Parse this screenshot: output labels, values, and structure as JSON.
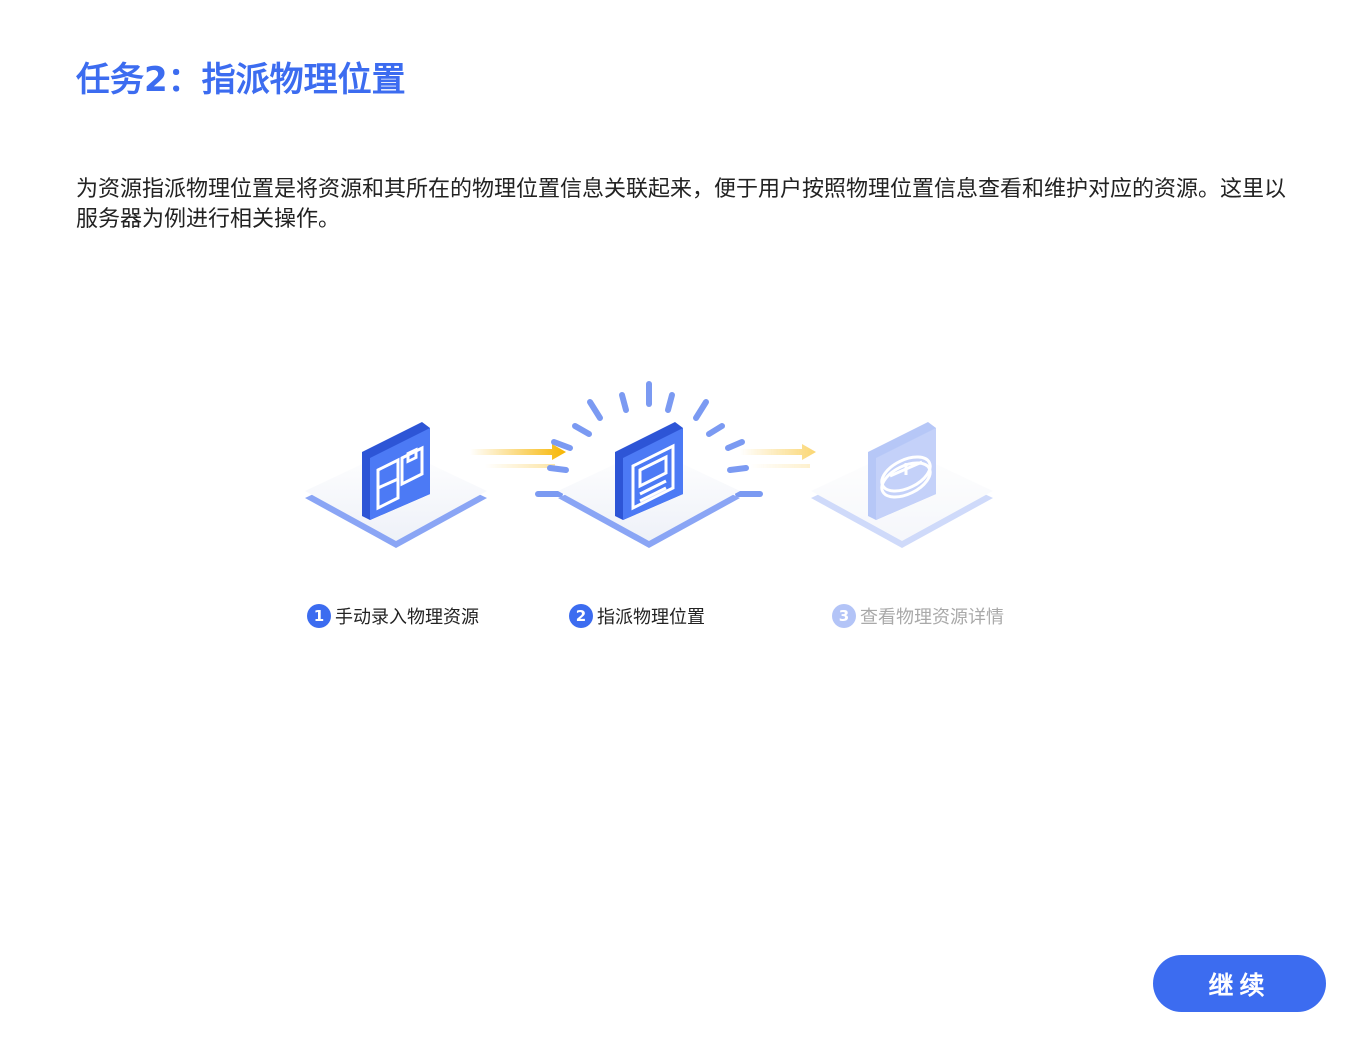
{
  "title": "任务2：指派物理位置",
  "description": "为资源指派物理位置是将资源和其所在的物理位置信息关联起来，便于用户按照物理位置信息查看和维护对应的资源。这里以服务器为例进行相关操作。",
  "steps": [
    {
      "number": "1",
      "label": "手动录入物理资源",
      "icon": "grid-panel-icon",
      "state": "done"
    },
    {
      "number": "2",
      "label": "指派物理位置",
      "icon": "document-panel-icon",
      "state": "current"
    },
    {
      "number": "3",
      "label": "查看物理资源详情",
      "icon": "disk-panel-icon",
      "state": "pending"
    }
  ],
  "continue_button": {
    "label": "继续"
  },
  "colors": {
    "accent": "#3c6cf0",
    "arrow": "#f7b500",
    "inactive_text": "#a9a9a9",
    "inactive_accent": "#b3c4f7"
  }
}
